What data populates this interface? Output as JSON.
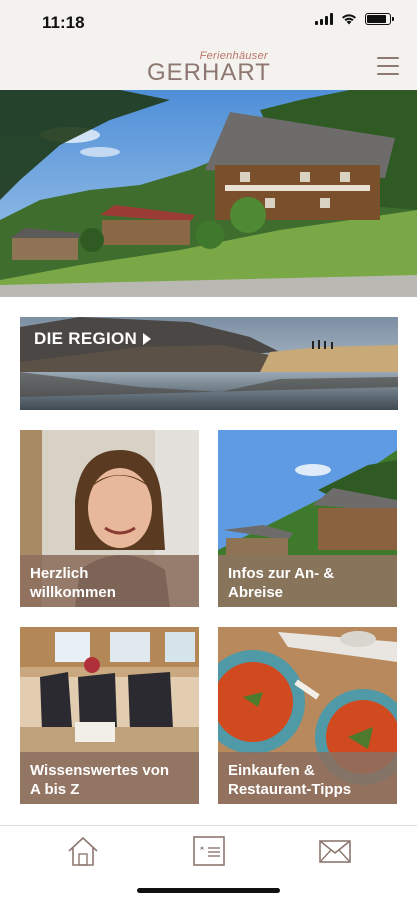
{
  "status_bar": {
    "time": "11:18"
  },
  "header": {
    "logo_top": "Ferienhäuser",
    "logo_main": "GERHART"
  },
  "region_banner": {
    "label": "DIE REGION"
  },
  "tiles": [
    {
      "label_line1": "Herzlich",
      "label_line2": "willkommen"
    },
    {
      "label_line1": "Infos zur An- &",
      "label_line2": "Abreise"
    },
    {
      "label_line1": "Wissenswertes von",
      "label_line2": "A bis Z"
    },
    {
      "label_line1": "Einkaufen &",
      "label_line2": "Restaurant-Tipps"
    }
  ],
  "tabbar": {
    "items": [
      "home-icon",
      "id-card-icon",
      "mail-icon"
    ]
  },
  "colors": {
    "brand": "#8d7770",
    "accent": "#b97468",
    "tile_label_bg": "#8c6e5f"
  }
}
